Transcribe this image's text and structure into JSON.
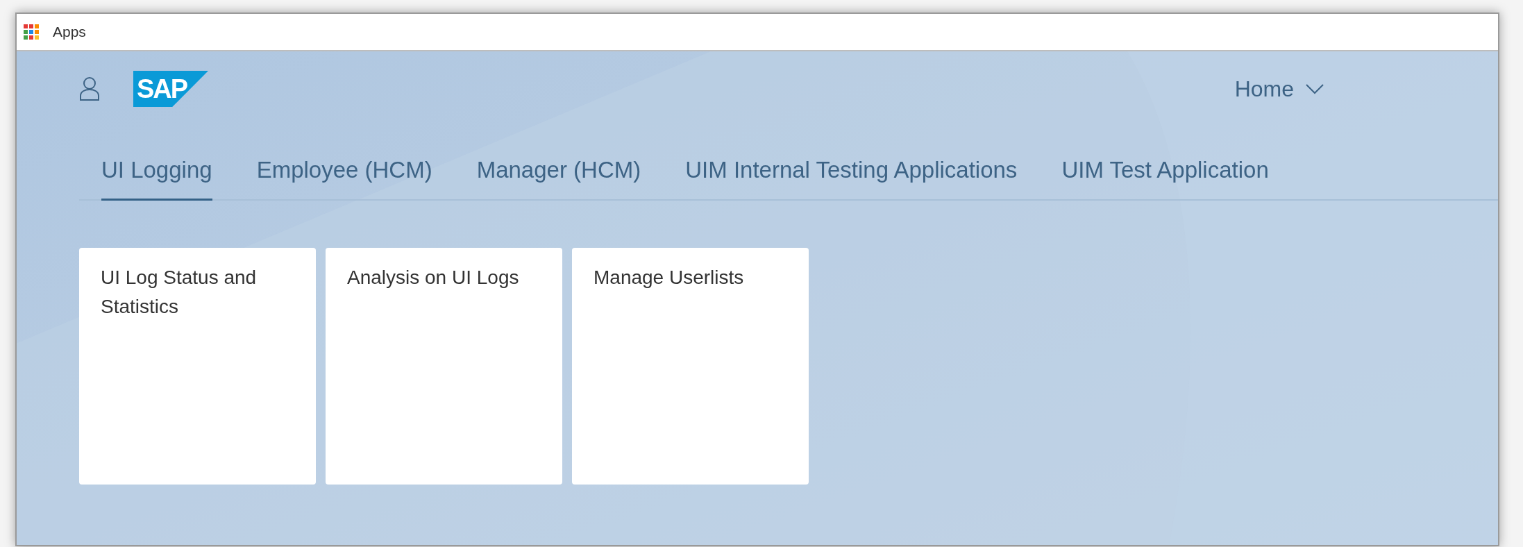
{
  "window": {
    "title": "Apps"
  },
  "header": {
    "logo": "SAP",
    "home_menu": "Home"
  },
  "tabs": [
    {
      "label": "UI Logging",
      "selected": true
    },
    {
      "label": "Employee (HCM)",
      "selected": false
    },
    {
      "label": "Manager (HCM)",
      "selected": false
    },
    {
      "label": "UIM Internal Testing Applications",
      "selected": false
    },
    {
      "label": "UIM Test Application",
      "selected": false
    }
  ],
  "tiles": [
    {
      "title": "UI Log Status and Statistics"
    },
    {
      "title": "Analysis on UI Logs"
    },
    {
      "title": "Manage Userlists"
    }
  ]
}
